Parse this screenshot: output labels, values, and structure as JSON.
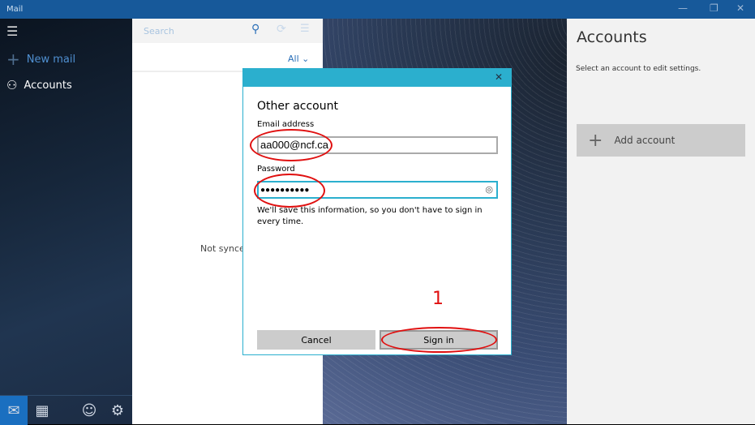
{
  "window": {
    "title": "Mail"
  },
  "nav": {
    "new_mail": "New mail",
    "accounts": "Accounts"
  },
  "list": {
    "search_placeholder": "Search",
    "filter": "All",
    "status": "Not synced"
  },
  "right": {
    "title": "Accounts",
    "subtitle": "Select an account to edit settings.",
    "add_account": "Add account"
  },
  "dialog": {
    "title": "Other account",
    "email_label": "Email address",
    "email_value": "aa000@ncf.ca",
    "password_label": "Password",
    "password_value": "●●●●●●●●●●",
    "note": "We'll save this information, so you don't have to sign in every time.",
    "cancel": "Cancel",
    "sign_in": "Sign in"
  },
  "annotation": {
    "step": "1",
    "color": "#e01010"
  },
  "colors": {
    "titlebar": "#17599a",
    "dialog_accent": "#2bafce"
  }
}
